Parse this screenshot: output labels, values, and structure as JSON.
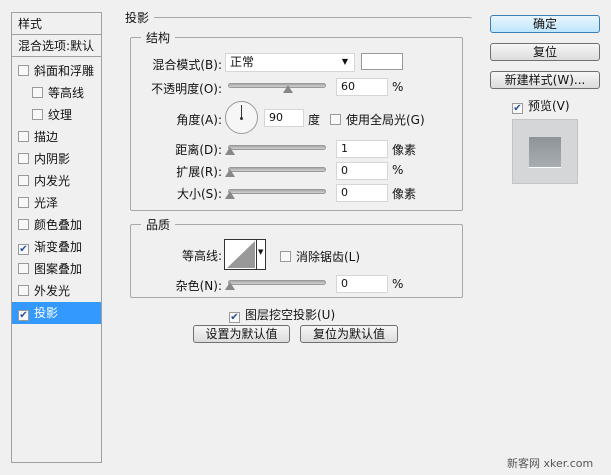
{
  "sidebar": {
    "header": "样式",
    "blend_options": "混合选项:默认",
    "items": [
      {
        "label": "斜面和浮雕",
        "checked": false
      },
      {
        "label": "等高线",
        "checked": false
      },
      {
        "label": "纹理",
        "checked": false
      },
      {
        "label": "描边",
        "checked": false
      },
      {
        "label": "内阴影",
        "checked": false
      },
      {
        "label": "内发光",
        "checked": false
      },
      {
        "label": "光泽",
        "checked": false
      },
      {
        "label": "颜色叠加",
        "checked": false
      },
      {
        "label": "渐变叠加",
        "checked": true
      },
      {
        "label": "图案叠加",
        "checked": false
      },
      {
        "label": "外发光",
        "checked": false
      },
      {
        "label": "投影",
        "checked": true
      }
    ]
  },
  "panel": {
    "title": "投影",
    "structure": {
      "title": "结构",
      "blend_mode_label": "混合模式(B):",
      "blend_mode_value": "正常",
      "opacity_label": "不透明度(O):",
      "opacity_value": "60",
      "opacity_unit": "%",
      "angle_label": "角度(A):",
      "angle_value": "90",
      "angle_unit": "度",
      "global_light_label": "使用全局光(G)",
      "global_light_checked": false,
      "distance_label": "距离(D):",
      "distance_value": "1",
      "distance_unit": "像素",
      "spread_label": "扩展(R):",
      "spread_value": "0",
      "spread_unit": "%",
      "size_label": "大小(S):",
      "size_value": "0",
      "size_unit": "像素"
    },
    "quality": {
      "title": "品质",
      "contour_label": "等高线:",
      "anti_alias_label": "消除锯齿(L)",
      "anti_alias_checked": false,
      "noise_label": "杂色(N):",
      "noise_value": "0",
      "noise_unit": "%"
    },
    "knockout_label": "图层挖空投影(U)",
    "knockout_checked": true,
    "make_default": "设置为默认值",
    "reset_default": "复位为默认值"
  },
  "buttons": {
    "ok": "确定",
    "reset": "复位",
    "new_style": "新建样式(W)...",
    "preview_label": "预览(V)",
    "preview_checked": true
  },
  "watermark": "新客网 xker.com"
}
